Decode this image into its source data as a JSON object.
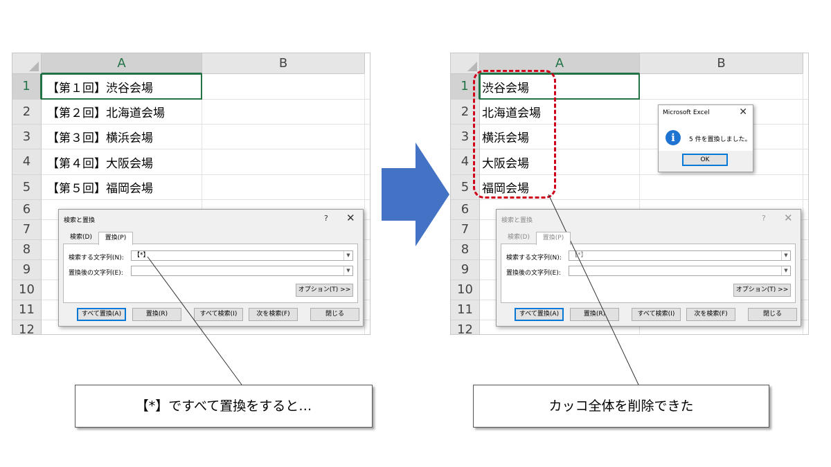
{
  "left": {
    "columns": [
      "A",
      "B"
    ],
    "rows": [
      "1",
      "2",
      "3",
      "4",
      "5",
      "6",
      "7",
      "8",
      "9",
      "10",
      "11",
      "12"
    ],
    "cells": [
      "【第１回】渋谷会場",
      "【第２回】北海道会場",
      "【第３回】横浜会場",
      "【第４回】大阪会場",
      "【第５回】福岡会場"
    ],
    "dialog": {
      "title": "検索と置換",
      "help": "?",
      "close": "✕",
      "tabs": [
        "検索(D)",
        "置換(P)"
      ],
      "find_label": "検索する文字列(N):",
      "find_value": "【*】",
      "replace_label": "置換後の文字列(E):",
      "replace_value": "",
      "options_button": "オプション(T) >>",
      "buttons": [
        "すべて置換(A)",
        "置換(R)",
        "すべて検索(I)",
        "次を検索(F)",
        "閉じる"
      ]
    },
    "callout": "【*】ですべて置換をすると…"
  },
  "right": {
    "columns": [
      "A",
      "B"
    ],
    "rows": [
      "1",
      "2",
      "3",
      "4",
      "5",
      "6",
      "7",
      "8",
      "9",
      "10",
      "11",
      "12"
    ],
    "cells": [
      "渋谷会場",
      "北海道会場",
      "横浜会場",
      "大阪会場",
      "福岡会場"
    ],
    "dialog": {
      "title": "検索と置換",
      "help": "?",
      "close": "✕",
      "tabs": [
        "検索(D)",
        "置換(P)"
      ],
      "find_label": "検索する文字列(N):",
      "find_value": "【*】",
      "replace_label": "置換後の文字列(E):",
      "replace_value": "",
      "options_button": "オプション(T) >>",
      "buttons": [
        "すべて置換(A)",
        "置換(R)",
        "すべて検索(I)",
        "次を検索(F)",
        "閉じる"
      ]
    },
    "message_box": {
      "title": "Microsoft Excel",
      "close": "✕",
      "icon": "info-icon",
      "text": "5 件を置換しました。",
      "ok": "OK"
    },
    "callout": "カッコ全体を削除できた"
  },
  "colors": {
    "arrow": "#4472c4",
    "highlight": "#d0001b",
    "excel_green": "#217346",
    "info_blue": "#1e74d0"
  }
}
